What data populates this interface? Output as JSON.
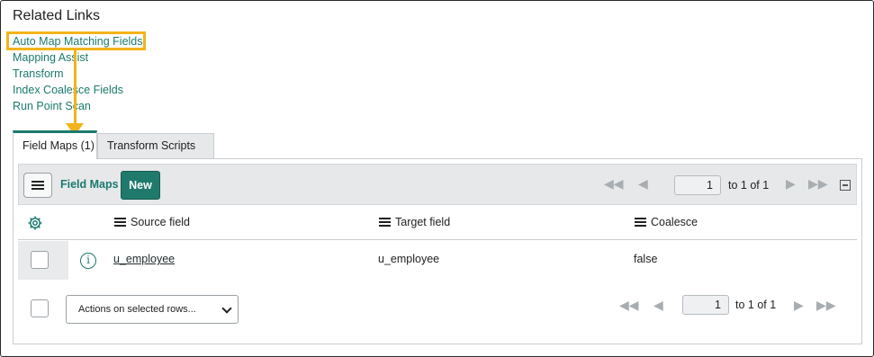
{
  "related_links": {
    "title": "Related Links",
    "items": [
      {
        "label": "Auto Map Matching Fields"
      },
      {
        "label": "Mapping Assist"
      },
      {
        "label": "Transform"
      },
      {
        "label": "Index Coalesce Fields"
      },
      {
        "label": "Run Point Scan"
      }
    ]
  },
  "annotation": {
    "color": "#f3b31a"
  },
  "tabs": [
    {
      "label": "Field Maps (1)",
      "active": true
    },
    {
      "label": "Transform Scripts",
      "active": false
    }
  ],
  "toolbar": {
    "menu_icon": "hamburger-icon",
    "title": "Field Maps",
    "new_label": "New"
  },
  "pager": {
    "first_icon": "first-page-icon",
    "prev_icon": "previous-page-icon",
    "next_icon": "next-page-icon",
    "last_icon": "last-page-icon",
    "page": "1",
    "range_text": "to 1 of 1"
  },
  "table": {
    "settings_icon": "gear-icon",
    "columns": [
      {
        "label": "Source field"
      },
      {
        "label": "Target field"
      },
      {
        "label": "Coalesce"
      }
    ],
    "rows": [
      {
        "source": "u_employee",
        "target": "u_employee",
        "coalesce": "false",
        "info_icon": "info-icon"
      }
    ]
  },
  "footer": {
    "actions_label": "Actions on selected rows...",
    "page": "1",
    "range_text": "to 1 of 1"
  },
  "colors": {
    "accent": "#1b7a6e",
    "button": "#1f7a6b",
    "highlight": "#f3b31a"
  }
}
